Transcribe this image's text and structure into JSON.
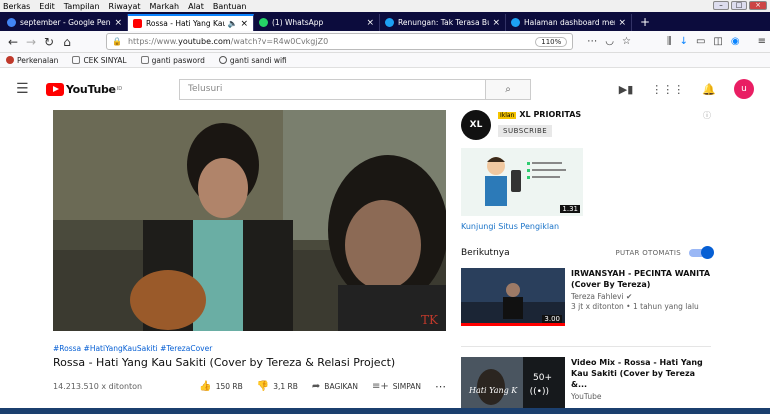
{
  "menubar": {
    "items": [
      "Berkas",
      "Edit",
      "Tampilan",
      "Riwayat",
      "Markah",
      "Alat",
      "Bantuan"
    ]
  },
  "tabs": [
    {
      "label": "september - Google Penelusur",
      "color": "#4285f4"
    },
    {
      "label": "Rossa - Hati Yang Kau Sakiti",
      "color": "#ff0000",
      "active": true
    },
    {
      "label": "(1) WhatsApp",
      "color": "#25d366"
    },
    {
      "label": "Renungan: Tak Terasa Bulan S",
      "color": "#1da1f2"
    },
    {
      "label": "Halaman dashboard menulis",
      "color": "#1da1f2"
    }
  ],
  "url": {
    "prefix": "https://www.",
    "host": "youtube.com",
    "path": "/watch?v=R4w0CvkgjZ0",
    "zoom": "110%"
  },
  "bookmarks": [
    "Perkenalan",
    "CEK SINYAL",
    "ganti pasword",
    "ganti sandi wifi"
  ],
  "header": {
    "logo": "YouTube",
    "region": "ID",
    "search_placeholder": "Telusuri",
    "avatar_letter": "u"
  },
  "video": {
    "hashtags": "#Rossa #HatiYangKauSakiti #TerezaCover",
    "title": "Rossa - Hati Yang Kau Sakiti (Cover by Tereza & Relasi Project)",
    "views": "14.213.510 x ditonton",
    "likes": "150 RB",
    "dislikes": "3,1 RB",
    "share": "BAGIKAN",
    "save": "SIMPAN",
    "watermark": "TK"
  },
  "ad": {
    "badge": "Iklan",
    "name": "XL PRIORITAS",
    "subscribe": "SUBSCRIBE",
    "duration": "1.31",
    "link": "Kunjungi Situs Pengiklan",
    "logo_text": "XL"
  },
  "next": {
    "heading": "Berikutnya",
    "autoplay": "PUTAR OTOMATIS"
  },
  "recs": [
    {
      "title": "IRWANSYAH - PECINTA WANITA (Cover By Tereza)",
      "channel": "Tereza Fahlevi",
      "meta": "3 jt x ditonton • 1 tahun yang lalu",
      "duration": "3.00"
    },
    {
      "title": "Video Mix - Rossa - Hati Yang Kau Sakiti (Cover by Tereza &...",
      "channel": "YouTube",
      "meta": "",
      "duration": "50+"
    }
  ]
}
